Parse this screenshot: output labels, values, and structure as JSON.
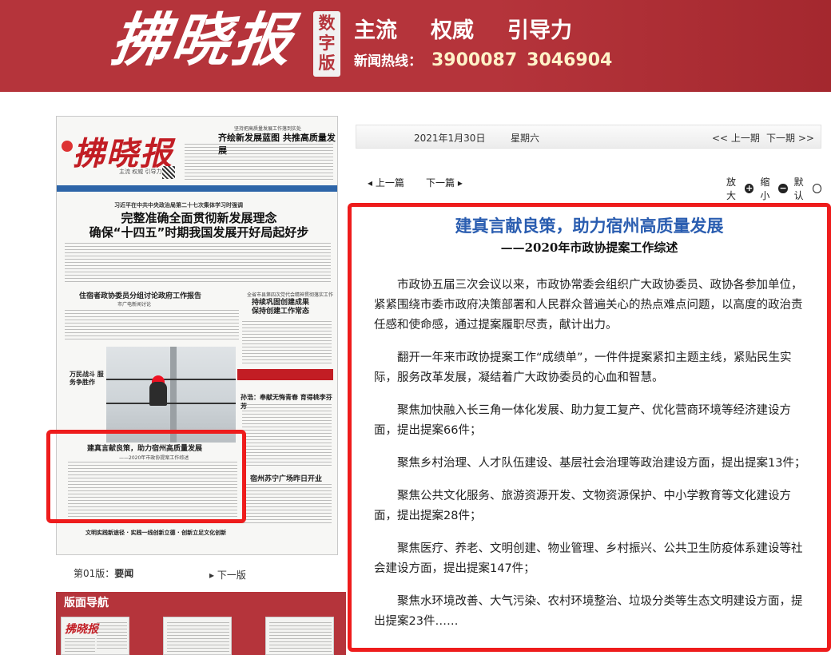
{
  "header": {
    "logo_text": "拂晓报",
    "digital_badge": "数字版",
    "slogan": [
      "主流",
      "权威",
      "引导力"
    ],
    "hotline_label": "新闻热线：",
    "hotline_numbers": [
      "3900087",
      "3046904"
    ]
  },
  "page_thumbnail": {
    "paper_logo": "拂晓报",
    "tagline": "主流 权威 引导力",
    "top_kicker": "坚持把高质量发展工作落到实处",
    "top_title": "齐绘新发展蓝图 共推高质量发展",
    "kicker": "习近平在中共中央政治局第二十七次集体学习时强调",
    "headline_lines": [
      "完整准确全面贯彻新发展理念",
      "确保“十四五”时期我国发展开好局起好步"
    ],
    "sub_story_1": "住宿者政协委员分组讨论政府工作报告",
    "sub_story_1_meta": "市广电新闻讨论",
    "sub_story_2_kicker": "全省市县第四次党代会精神贯彻落实工作",
    "sub_story_2_lines": [
      "持续巩固创建成果",
      "保持创建工作常态"
    ],
    "photo_caption": "万民战斗 服务争胜作",
    "sub_story_3": "孙浩：奉献无悔青春 育得桃李芬芳",
    "featured_title": "建真言献良策，助力宿州高质量发展",
    "featured_sub": "——2020年市政协提案工作综述",
    "sub_story_4": "宿州苏宁广场昨日开业",
    "bottom_line": "文明实践新途径 · 实践一线创新立德 · 创新立足文化创新"
  },
  "page_label": "第01版：",
  "page_name": "要闻",
  "next_page": "下一版",
  "section_nav": {
    "title": "版面导航",
    "thumbnail_logo": "拂晓报"
  },
  "issue_bar": {
    "date": "2021年1月30日",
    "weekday": "星期六",
    "prev_issue": "<< 上一期",
    "next_issue": "下一期 >>"
  },
  "article_toolbar": {
    "prev_article": "◂ 上一篇",
    "next_article": "下一篇 ▸",
    "zoom_in": "放大",
    "zoom_out": "缩小",
    "default": "默认"
  },
  "article": {
    "title": "建真言献良策，助力宿州高质量发展",
    "subtitle": "——2020年市政协提案工作综述",
    "paragraphs": [
      "市政协五届三次会议以来，市政协常委会组织广大政协委员、政协各参加单位，紧紧围绕市委市政府决策部署和人民群众普遍关心的热点难点问题，以高度的政治责任感和使命感，通过提案履职尽责，献计出力。",
      "翻开一年来市政协提案工作“成绩单”，一件件提案紧扣主题主线，紧贴民生实际，服务改革发展，凝结着广大政协委员的心血和智慧。",
      "聚焦加快融入长三角一体化发展、助力复工复产、优化营商环境等经济建设方面，提出提案66件；",
      "聚焦乡村治理、人才队伍建设、基层社会治理等政治建设方面，提出提案13件；",
      "聚焦公共文化服务、旅游资源开发、文物资源保护、中小学教育等文化建设方面，提出提案28件；",
      "聚焦医疗、养老、文明创建、物业管理、乡村振兴、公共卫生防疫体系建设等社会建设方面，提出提案147件；",
      "聚焦水环境改善、大气污染、农村环境整治、垃圾分类等生态文明建设方面，提出提案23件……"
    ]
  },
  "colors": {
    "brand_red": "#b5343b",
    "highlight_red": "#ee1c1c",
    "title_blue": "#2a5db0"
  }
}
